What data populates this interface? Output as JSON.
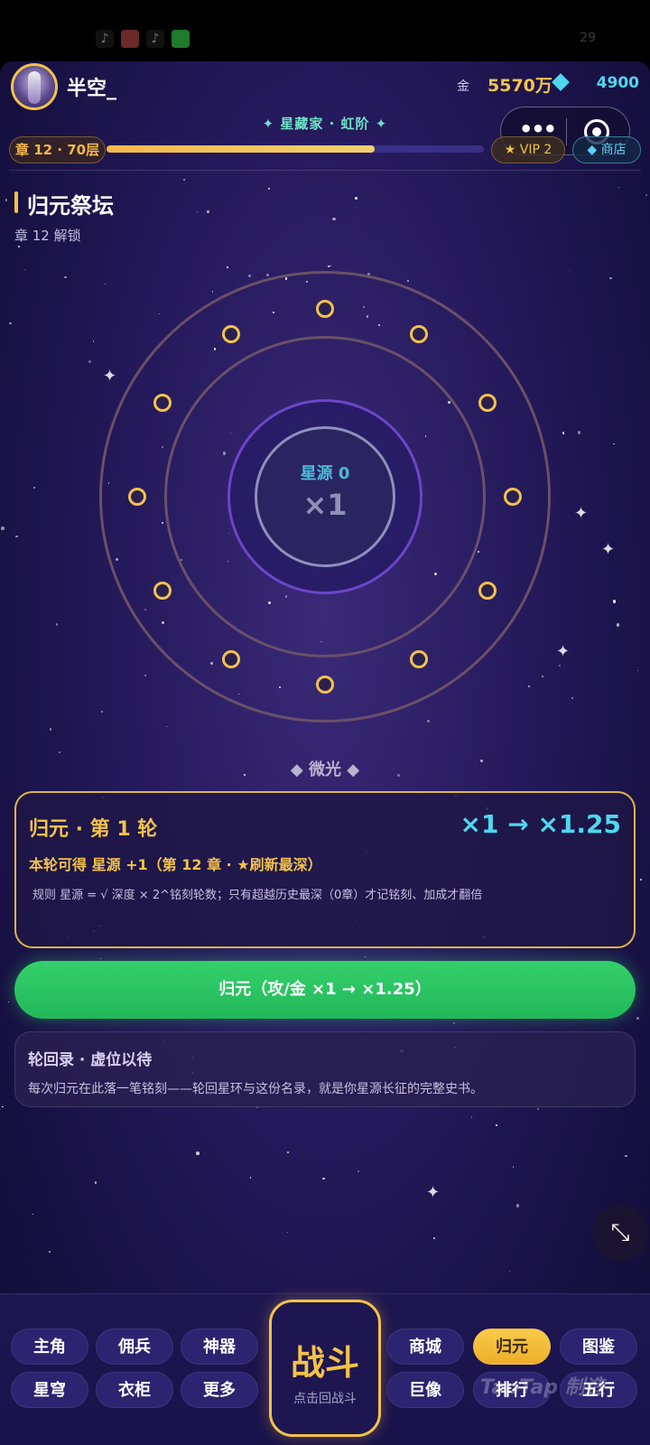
{
  "statusbar": {
    "icon_tiktok": "♪",
    "clock": "29"
  },
  "header": {
    "username": "半空_",
    "gold_label": "金",
    "gold_value": "5570万",
    "gem_value": "4900",
    "title": "✦ 星藏家 · 虹阶 ✦",
    "chapter": "章 12 · 70层",
    "progress": 0.71,
    "vip": "★ VIP 2",
    "shop": "◆ 商店",
    "more": "•••"
  },
  "section": {
    "title": "归元祭坛",
    "subtitle": "章 12 解锁"
  },
  "altar": {
    "core_label": "星源 0",
    "core_mult": "×1",
    "status": "◆ 微光 ◆"
  },
  "round": {
    "title": "归元 · 第 1 轮",
    "mult": "×1 → ×1.25",
    "gain": "本轮可得 星源 +1（第 12 章 · ★刷新最深）",
    "rule": "规则 星源 = √ 深度 × 2^铭刻轮数；只有超越历史最深（0章）才记铭刻、加成才翻倍"
  },
  "action": {
    "ascend_label": "归元（攻/金 ×1 → ×1.25）"
  },
  "record": {
    "title": "轮回录 · 虚位以待",
    "desc": "每次归元在此落一笔铭刻——轮回星环与这份名录，就是你星源长征的完整史书。"
  },
  "fab": {
    "collapse_glyph": "⤡"
  },
  "nav": {
    "left_row1": [
      "主角",
      "佣兵",
      "神器"
    ],
    "left_row2": [
      "星穹",
      "衣柜",
      "更多"
    ],
    "right_row1": [
      "商城",
      "归元",
      "图鉴"
    ],
    "right_row2": [
      "巨像",
      "排行",
      "五行"
    ],
    "active": "归元",
    "battle_label": "战斗",
    "battle_sub": "点击回战斗"
  },
  "watermark": "TapTap 制造",
  "colors": {
    "accent_gold": "#f3c24a",
    "accent_cyan": "#4fd7ef",
    "primary_green": "#2ac462",
    "bg_purple": "#24195a"
  }
}
